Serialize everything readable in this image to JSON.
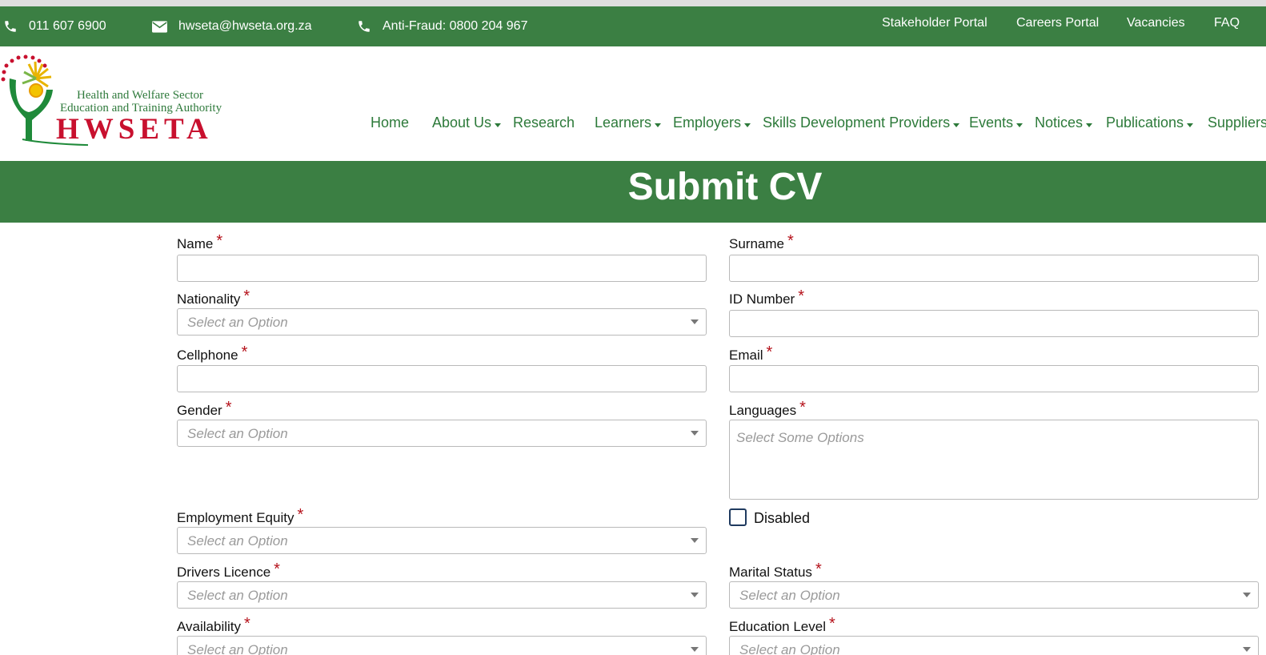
{
  "topbar": {
    "phone": "011 607 6900",
    "email": "hwseta@hwseta.org.za",
    "antifraud": "Anti-Fraud: 0800 204 967",
    "links": [
      "Stakeholder Portal",
      "Careers Portal",
      "Vacancies",
      "FAQ"
    ]
  },
  "logo": {
    "subtitle1": "Health and Welfare Sector",
    "subtitle2": "Education and Training Authority",
    "name": "HWSETA"
  },
  "nav": {
    "items": [
      "Home",
      "About Us",
      "Research",
      "Learners",
      "Employers",
      "Skills Development Providers",
      "Events",
      "Notices",
      "Publications",
      "Suppliers"
    ]
  },
  "banner": {
    "title": "Submit CV"
  },
  "form": {
    "required_mark": "*",
    "select_placeholder": "Select an Option",
    "multi_placeholder": "Select Some Options",
    "labels": {
      "name": "Name",
      "surname": "Surname",
      "nationality": "Nationality",
      "id_number": "ID Number",
      "cellphone": "Cellphone",
      "email": "Email",
      "gender": "Gender",
      "languages": "Languages",
      "employment_equity": "Employment Equity",
      "disabled": "Disabled",
      "drivers_licence": "Drivers Licence",
      "marital_status": "Marital Status",
      "availability": "Availability",
      "education_level": "Education Level"
    }
  },
  "colors": {
    "brand_green": "#3b7f43",
    "nav_green": "#2d7a3a",
    "required_red": "#b5121b",
    "logo_red": "#c8102e"
  },
  "icons": [
    "phone-icon",
    "envelope-icon",
    "phone-icon",
    "hwseta-logo-emblem",
    "chevron-down-icon"
  ]
}
